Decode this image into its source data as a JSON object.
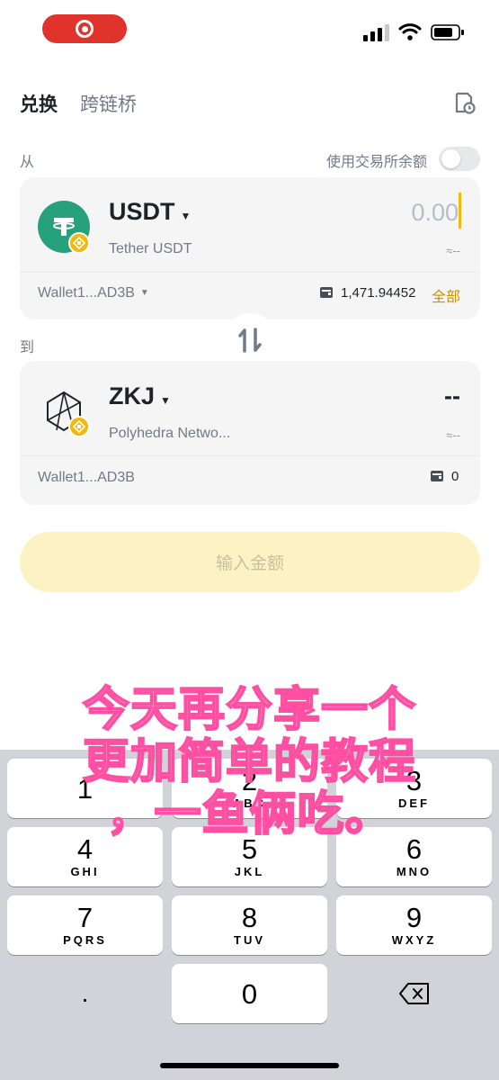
{
  "status_bar": {
    "record_icon": "screen-record-icon",
    "signal_icon": "signal-icon",
    "wifi_icon": "wifi-icon",
    "battery_icon": "battery-icon"
  },
  "header": {
    "tabs": [
      {
        "label": "兑换",
        "active": true
      },
      {
        "label": "跨链桥",
        "active": false
      }
    ],
    "history_icon": "history-icon"
  },
  "from": {
    "label": "从",
    "use_exchange_balance_label": "使用交易所余额",
    "use_exchange_balance_on": false,
    "token": {
      "symbol": "USDT",
      "name": "Tether USDT",
      "logo": "tether-logo"
    },
    "amount": "0.00",
    "fiat": "≈--",
    "wallet": "Wallet1...AD3B",
    "balance": "1,471.94452",
    "max_label": "全部"
  },
  "swap_icon": "swap-arrows-icon",
  "to": {
    "label": "到",
    "token": {
      "symbol": "ZKJ",
      "name": "Polyhedra Netwo...",
      "logo": "polyhedra-logo"
    },
    "amount": "--",
    "fiat": "≈--",
    "wallet": "Wallet1...AD3B",
    "balance": "0"
  },
  "cta": {
    "label": "输入金额"
  },
  "keypad": {
    "keys": [
      {
        "num": "1",
        "letters": ""
      },
      {
        "num": "2",
        "letters": "ABC"
      },
      {
        "num": "3",
        "letters": "DEF"
      },
      {
        "num": "4",
        "letters": "GHI"
      },
      {
        "num": "5",
        "letters": "JKL"
      },
      {
        "num": "6",
        "letters": "MNO"
      },
      {
        "num": "7",
        "letters": "PQRS"
      },
      {
        "num": "8",
        "letters": "TUV"
      },
      {
        "num": "9",
        "letters": "WXYZ"
      },
      {
        "num": "0",
        "letters": ""
      }
    ],
    "decimal": ".",
    "delete_icon": "backspace-icon"
  },
  "overlay_caption": {
    "line1": "今天再分享一个",
    "line2": "更加简单的教程",
    "line3": "，一鱼俩吃。"
  },
  "colors": {
    "accent": "#f0b90b",
    "cta_bg": "#fcf2c3",
    "tether": "#26a17b",
    "caption_pink": "#ff4fa3"
  }
}
